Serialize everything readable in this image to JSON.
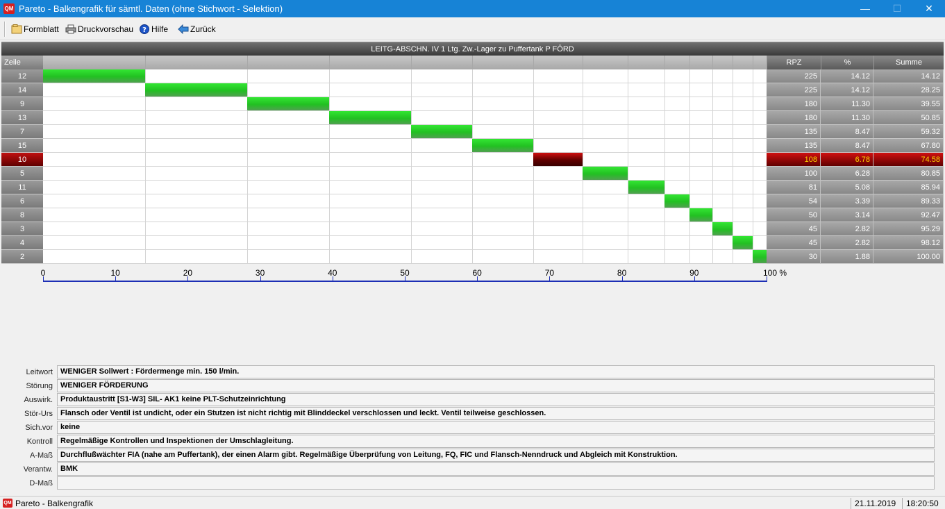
{
  "window": {
    "icon_text": "QM",
    "title": "Pareto - Balkengrafik für sämtl. Daten (ohne Stichwort - Selektion)",
    "minimize": "—",
    "maximize": "☐",
    "close": "✕"
  },
  "toolbar": {
    "formblatt": "Formblatt",
    "druckvorschau": "Druckvorschau",
    "hilfe": "Hilfe",
    "zurueck": "Zurück"
  },
  "chart": {
    "title": "LEITG-ABSCHN. IV  1  Ltg. Zw.-Lager zu Puffertank  P  FÖRD",
    "headers": {
      "row": "Zeile",
      "rpz": "RPZ",
      "pct": "%",
      "sum": "Summe"
    },
    "axis_unit": "100 %",
    "selected_color": "#8b0000",
    "bar_color": "#22c022"
  },
  "chart_data": {
    "type": "bar",
    "orientation": "horizontal-pareto",
    "x_range": [
      0,
      100
    ],
    "x_ticks": [
      "0",
      "10",
      "20",
      "30",
      "40",
      "50",
      "60",
      "70",
      "80",
      "90",
      "100 %"
    ],
    "rows": [
      {
        "zeile": "12",
        "rpz": "225",
        "pct": "14.12",
        "sum": "14.12"
      },
      {
        "zeile": "14",
        "rpz": "225",
        "pct": "14.12",
        "sum": "28.25"
      },
      {
        "zeile": "9",
        "rpz": "180",
        "pct": "11.30",
        "sum": "39.55"
      },
      {
        "zeile": "13",
        "rpz": "180",
        "pct": "11.30",
        "sum": "50.85"
      },
      {
        "zeile": "7",
        "rpz": "135",
        "pct": "8.47",
        "sum": "59.32"
      },
      {
        "zeile": "15",
        "rpz": "135",
        "pct": "8.47",
        "sum": "67.80"
      },
      {
        "zeile": "10",
        "rpz": "108",
        "pct": "6.78",
        "sum": "74.58",
        "selected": true
      },
      {
        "zeile": "5",
        "rpz": "100",
        "pct": "6.28",
        "sum": "80.85"
      },
      {
        "zeile": "11",
        "rpz": "81",
        "pct": "5.08",
        "sum": "85.94"
      },
      {
        "zeile": "6",
        "rpz": "54",
        "pct": "3.39",
        "sum": "89.33"
      },
      {
        "zeile": "8",
        "rpz": "50",
        "pct": "3.14",
        "sum": "92.47"
      },
      {
        "zeile": "3",
        "rpz": "45",
        "pct": "2.82",
        "sum": "95.29"
      },
      {
        "zeile": "4",
        "rpz": "45",
        "pct": "2.82",
        "sum": "98.12"
      },
      {
        "zeile": "2",
        "rpz": "30",
        "pct": "1.88",
        "sum": "100.00"
      }
    ]
  },
  "details": [
    {
      "label": "Leitwort",
      "value": "WENIGER  Sollwert : Fördermenge min.  150 l/min."
    },
    {
      "label": "Störung",
      "value": "WENIGER FÖRDERUNG"
    },
    {
      "label": "Auswirk.",
      "value": "Produktaustritt  [S1-W3]  SIL-  AK1  keine  PLT-Schutzeinrichtung"
    },
    {
      "label": "Stör-Urs",
      "value": "Flansch oder Ventil ist  undicht, oder ein Stutzen  ist nicht richtig mit  Blinddeckel verschlossen  und leckt.  Ventil teilweise  geschlossen."
    },
    {
      "label": "Sich.vor",
      "value": "keine"
    },
    {
      "label": "Kontroll",
      "value": "Regelmäßige Kontrollen  und Inspektionen der  Umschlagleitung."
    },
    {
      "label": "A-Maß",
      "value": "Durchflußwächter FIA (nahe am Puffertank),  der einen Alarm gibt.  Regelmäßige Überprüfung  von Leitung, FQ, FIC und  Flansch-Nenndruck und  Abgleich mit Konstruktion."
    },
    {
      "label": "Verantw.",
      "value": "BMK"
    },
    {
      "label": "D-Maß",
      "value": ""
    }
  ],
  "status": {
    "app_label": "Pareto - Balkengrafik",
    "date": "21.11.2019",
    "time": "18:20:50"
  }
}
